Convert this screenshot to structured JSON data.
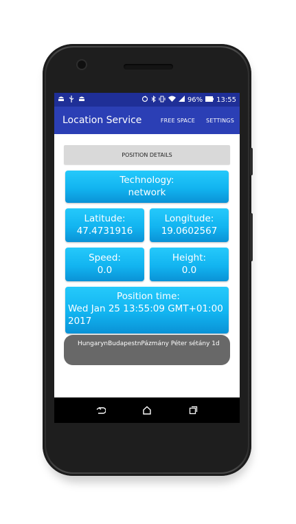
{
  "statusbar": {
    "battery": "96%",
    "time": "13:55",
    "left_icons": [
      "android-icon",
      "usb-icon",
      "android-icon"
    ],
    "right_icons": [
      "sync-icon",
      "bluetooth-icon",
      "vibrate-icon",
      "wifi-icon",
      "signal-icon",
      "battery-icon"
    ]
  },
  "appbar": {
    "title": "Location Service",
    "actions": [
      "FREE SPACE",
      "SETTINGS"
    ]
  },
  "position_details_button": "POSITION DETAILS",
  "technology": {
    "label": "Technology:",
    "value": "network"
  },
  "latitude": {
    "label": "Latitude:",
    "value": "47.4731916"
  },
  "longitude": {
    "label": "Longitude:",
    "value": "19.0602567"
  },
  "speed": {
    "label": "Speed:",
    "value": "0.0"
  },
  "height": {
    "label": "Height:",
    "value": "0.0"
  },
  "position_time": {
    "label": "Position time:",
    "value": "Wed Jan 25 13:55:09 GMT+01:00 2017"
  },
  "address": "HungarynBudapestnPázmány Péter sétány 1d",
  "colors": {
    "statusbar": "#1f2f97",
    "appbar": "#2b3fb5",
    "card_accent": "#12b4f0",
    "address_bg": "#686868"
  }
}
